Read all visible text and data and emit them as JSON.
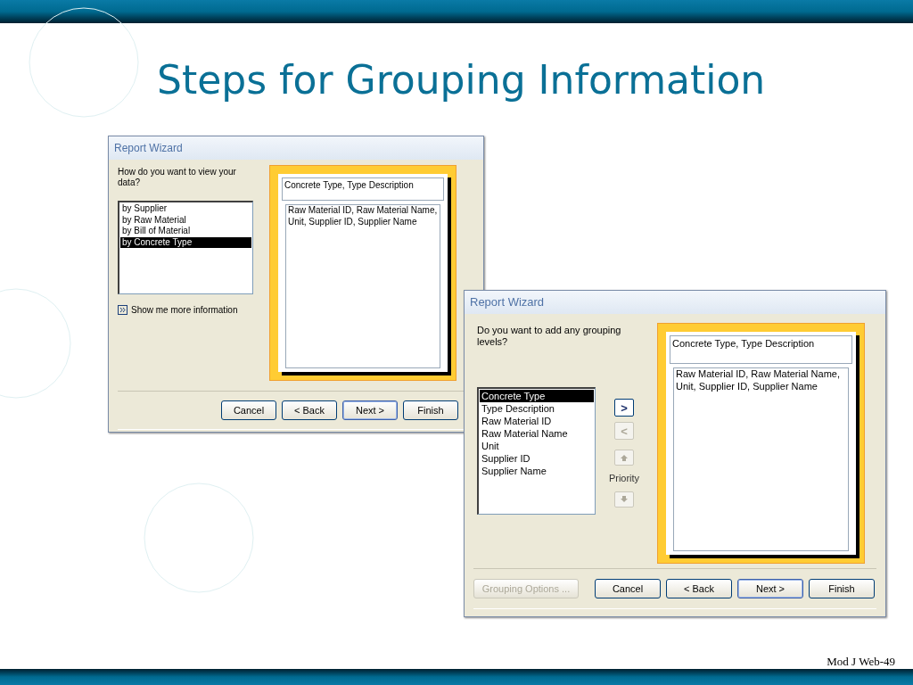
{
  "slide": {
    "title": "Steps for Grouping Information",
    "footer": "Mod J Web-49"
  },
  "dialogs": [
    {
      "kind": "view",
      "title": "Report Wizard",
      "question": "How do you want to view your data?",
      "list": [
        {
          "label": "by Supplier",
          "selected": false
        },
        {
          "label": "by Raw Material",
          "selected": false
        },
        {
          "label": "by Bill of Material",
          "selected": false
        },
        {
          "label": "by Concrete Type",
          "selected": true
        }
      ],
      "link": "Show me more information",
      "preview": {
        "group_header": "Concrete Type, Type Description",
        "detail": "Raw Material ID, Raw Material Name, Unit, Supplier ID, Supplier Name"
      },
      "buttons": [
        {
          "label": "Cancel",
          "disabled": false,
          "default": false
        },
        {
          "label": "< Back",
          "disabled": false,
          "default": false
        },
        {
          "label": "Next >",
          "disabled": false,
          "default": true
        },
        {
          "label": "Finish",
          "disabled": false,
          "default": false
        }
      ]
    },
    {
      "kind": "grouping",
      "title": "Report Wizard",
      "question": "Do you want to add any grouping levels?",
      "list": [
        {
          "label": "Concrete Type",
          "selected": true
        },
        {
          "label": "Type Description",
          "selected": false
        },
        {
          "label": "Raw Material ID",
          "selected": false
        },
        {
          "label": "Raw Material Name",
          "selected": false
        },
        {
          "label": "Unit",
          "selected": false
        },
        {
          "label": "Supplier ID",
          "selected": false
        },
        {
          "label": "Supplier Name",
          "selected": false
        }
      ],
      "move_buttons": [
        {
          "label": ">",
          "disabled": false
        },
        {
          "label": "<",
          "disabled": true
        }
      ],
      "priority": {
        "label": "Priority",
        "disabled": true
      },
      "preview": {
        "group_header": "Concrete Type, Type Description",
        "detail": "Raw Material ID, Raw Material Name, Unit, Supplier ID, Supplier Name"
      },
      "options_button": {
        "label": "Grouping Options ...",
        "disabled": true
      },
      "buttons": [
        {
          "label": "Cancel",
          "disabled": false,
          "default": false
        },
        {
          "label": "< Back",
          "disabled": false,
          "default": false
        },
        {
          "label": "Next >",
          "disabled": false,
          "default": true
        },
        {
          "label": "Finish",
          "disabled": false,
          "default": false
        }
      ]
    }
  ]
}
